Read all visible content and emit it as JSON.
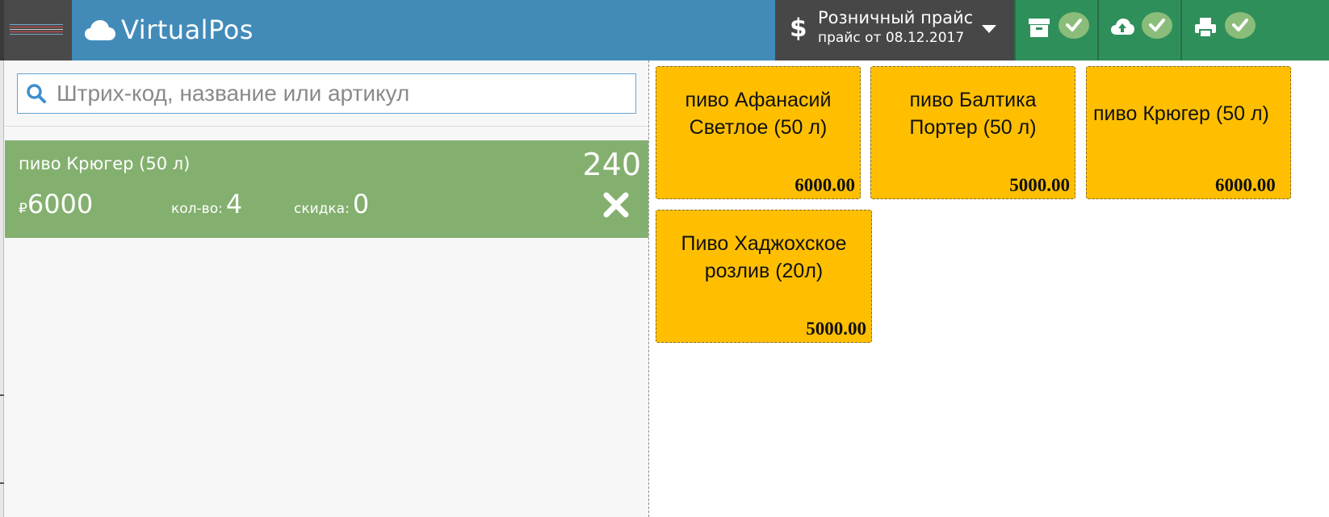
{
  "app": {
    "title": "VirtualPos"
  },
  "header": {
    "price_list": {
      "title": "Розничный прайс",
      "subtitle": "прайс от 08.12.2017",
      "currency_icon": "dollar-icon"
    },
    "actions": [
      {
        "name": "archive-button",
        "icon": "archive-icon",
        "status": "ok"
      },
      {
        "name": "sync-button",
        "icon": "cloud-upload-icon",
        "status": "ok"
      },
      {
        "name": "print-button",
        "icon": "printer-icon",
        "status": "ok"
      }
    ]
  },
  "search": {
    "placeholder": "Штрих-код, название или артикул",
    "value": ""
  },
  "cart": {
    "items": [
      {
        "name": "пиво Крюгер (50 л)",
        "total": "240",
        "currency": "₽",
        "price": "6000",
        "qty_label": "кол-во:",
        "qty": "4",
        "discount_label": "скидка:",
        "discount": "0"
      }
    ]
  },
  "products": [
    {
      "name": "пиво Афанасий Светлое (50 л)",
      "price": "6000.00"
    },
    {
      "name": "пиво Балтика Портер (50 л)",
      "price": "5000.00"
    },
    {
      "name": "пиво Крюгер (50 л)",
      "price": "6000.00"
    },
    {
      "name": "Пиво Хаджохское розлив (20л)",
      "price": "5000.00"
    }
  ],
  "colors": {
    "header": "#428bb8",
    "hamburger_bg": "#4a4a4a",
    "price_selector_bg": "#474747",
    "action_button_bg": "#2f8f5a",
    "status_ok": "#8bbd7a",
    "cart_item_bg": "#84b06f",
    "product_tile_bg": "#ffbf00",
    "search_border": "#66a4d6"
  }
}
